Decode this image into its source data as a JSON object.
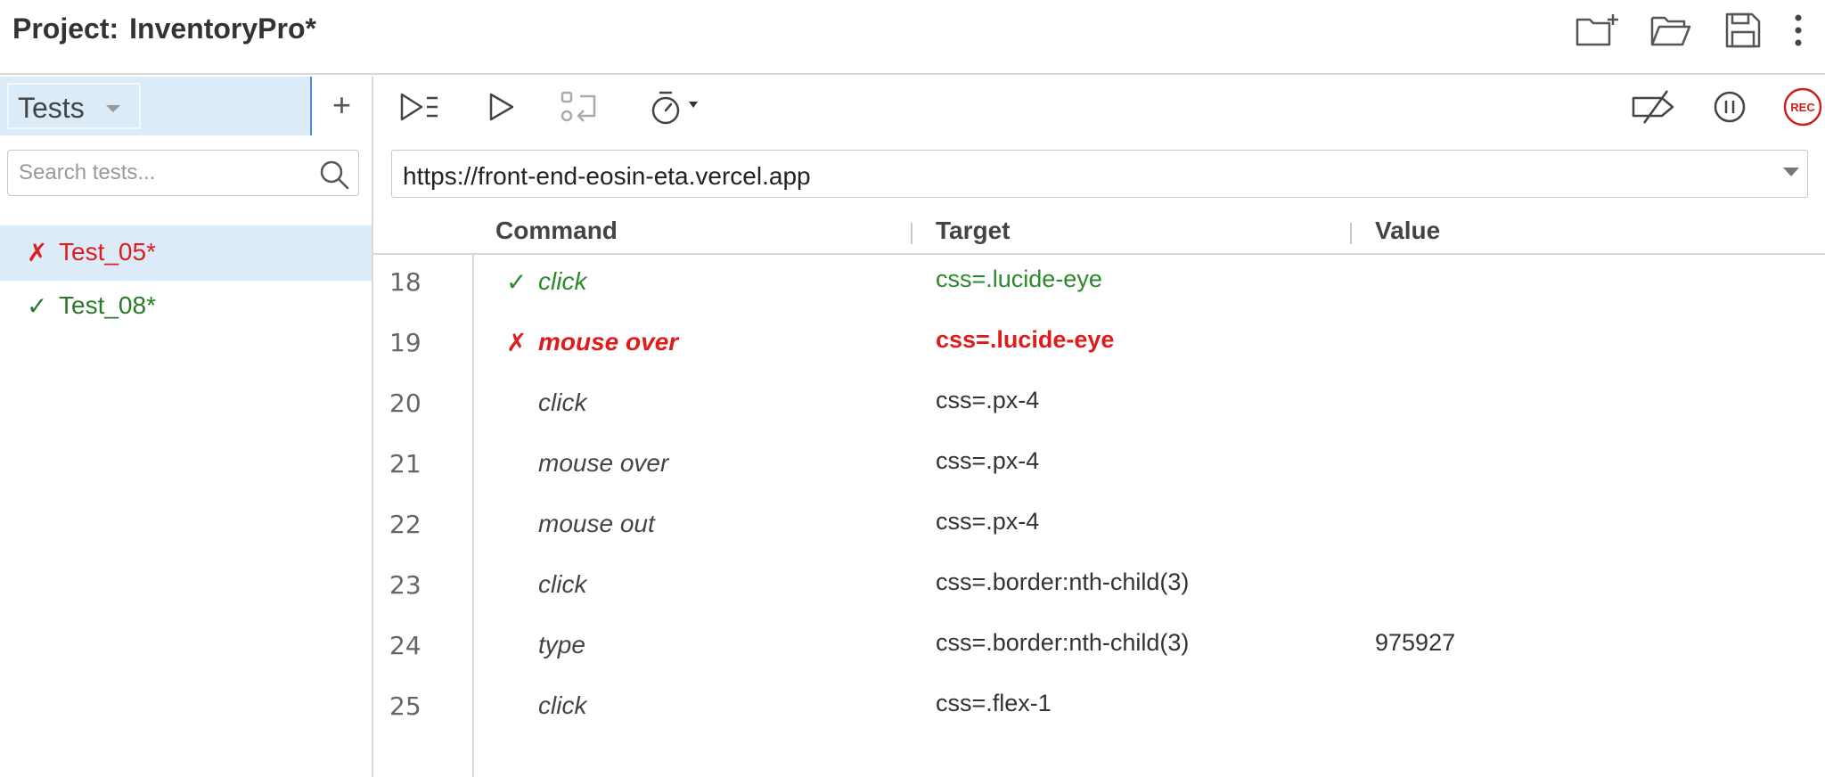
{
  "header": {
    "project_label": "Project:",
    "project_name": "InventoryPro*",
    "icons": [
      "new-project-icon",
      "open-folder-icon",
      "save-icon",
      "more-vertical-icon"
    ]
  },
  "sidebar": {
    "dropdown_label": "Tests",
    "add_label": "+",
    "search_placeholder": "Search tests...",
    "tests": [
      {
        "status": "fail",
        "mark": "✗",
        "name": "Test_05*",
        "selected": true
      },
      {
        "status": "pass",
        "mark": "✓",
        "name": "Test_08*",
        "selected": false
      }
    ]
  },
  "toolbar": {
    "icons": [
      "run-all-tests-icon",
      "run-test-icon",
      "step-over-icon",
      "speed-icon",
      "disable-breakpoints-icon",
      "pause-icon",
      "record-icon"
    ],
    "record_label": "REC"
  },
  "url": {
    "value": "https://front-end-eosin-eta.vercel.app"
  },
  "table": {
    "headers": {
      "command": "Command",
      "target": "Target",
      "value": "Value"
    },
    "rows": [
      {
        "line": "18",
        "status": "ok",
        "mark": "✓",
        "command": "click",
        "target": "css=.lucide-eye",
        "value": ""
      },
      {
        "line": "19",
        "status": "err",
        "mark": "✗",
        "command": "mouse over",
        "target": "css=.lucide-eye",
        "value": ""
      },
      {
        "line": "20",
        "status": "",
        "mark": "",
        "command": "click",
        "target": "css=.px-4",
        "value": ""
      },
      {
        "line": "21",
        "status": "",
        "mark": "",
        "command": "mouse over",
        "target": "css=.px-4",
        "value": ""
      },
      {
        "line": "22",
        "status": "",
        "mark": "",
        "command": "mouse out",
        "target": "css=.px-4",
        "value": ""
      },
      {
        "line": "23",
        "status": "",
        "mark": "",
        "command": "click",
        "target": "css=.border:nth-child(3)",
        "value": ""
      },
      {
        "line": "24",
        "status": "",
        "mark": "",
        "command": "type",
        "target": "css=.border:nth-child(3)",
        "value": "975927"
      },
      {
        "line": "25",
        "status": "",
        "mark": "",
        "command": "click",
        "target": "css=.flex-1",
        "value": ""
      }
    ]
  },
  "colors": {
    "fail": "#e01b1b",
    "pass": "#2a7a2a",
    "selected_bg": "#dcebf8",
    "accent": "#4a90d9",
    "record": "#cc1f1f"
  }
}
